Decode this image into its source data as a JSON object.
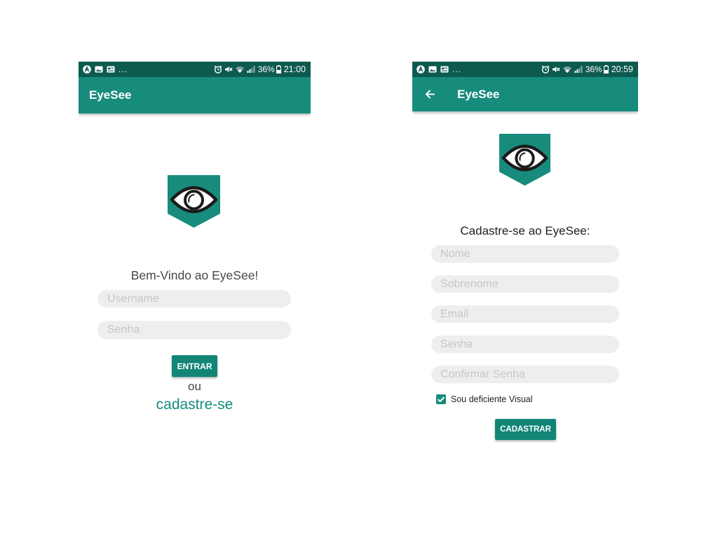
{
  "colors": {
    "primary": "#178c7d",
    "status_bar": "#0d5a4f",
    "button": "#128577",
    "input_background": "#eeeeee",
    "placeholder": "#c6c6c6",
    "text": "#474747",
    "heading": "#1f1f1f"
  },
  "login_screen": {
    "status_bar": {
      "left_icons": [
        "android-circle-icon",
        "image-icon",
        "card-icon"
      ],
      "overflow": "...",
      "right_icons": [
        "alarm-icon",
        "mute-icon",
        "wifi-icon",
        "signal-icon",
        "battery-icon"
      ],
      "battery_percent": "36%",
      "time": "21:00"
    },
    "app_bar": {
      "title": "EyeSee"
    },
    "logo_icon": "eye-logo-icon",
    "welcome_text": "Bem-Vindo ao EyeSee!",
    "username_input": {
      "placeholder": "Username",
      "value": ""
    },
    "password_input": {
      "placeholder": "Senha",
      "value": ""
    },
    "enter_button": "ENTRAR",
    "or_text": "ou",
    "register_link": "cadastre-se"
  },
  "register_screen": {
    "status_bar": {
      "left_icons": [
        "android-circle-icon",
        "image-icon",
        "card-icon"
      ],
      "overflow": "...",
      "right_icons": [
        "alarm-icon",
        "mute-icon",
        "wifi-icon",
        "signal-icon",
        "battery-icon"
      ],
      "battery_percent": "36%",
      "time": "20:59"
    },
    "app_bar": {
      "title": "EyeSee",
      "back_icon": "arrow-back-icon"
    },
    "logo_icon": "eye-logo-icon",
    "heading": "Cadastre-se ao EyeSee:",
    "fields": [
      {
        "placeholder": "Nome",
        "value": ""
      },
      {
        "placeholder": "Sobrenome",
        "value": ""
      },
      {
        "placeholder": "Email",
        "value": ""
      },
      {
        "placeholder": "Senha",
        "value": ""
      },
      {
        "placeholder": "Confirmar Senha",
        "value": ""
      }
    ],
    "visual_impairment_checkbox": {
      "label": "Sou deficiente Visual",
      "checked": true
    },
    "submit_button": "CADASTRAR"
  }
}
